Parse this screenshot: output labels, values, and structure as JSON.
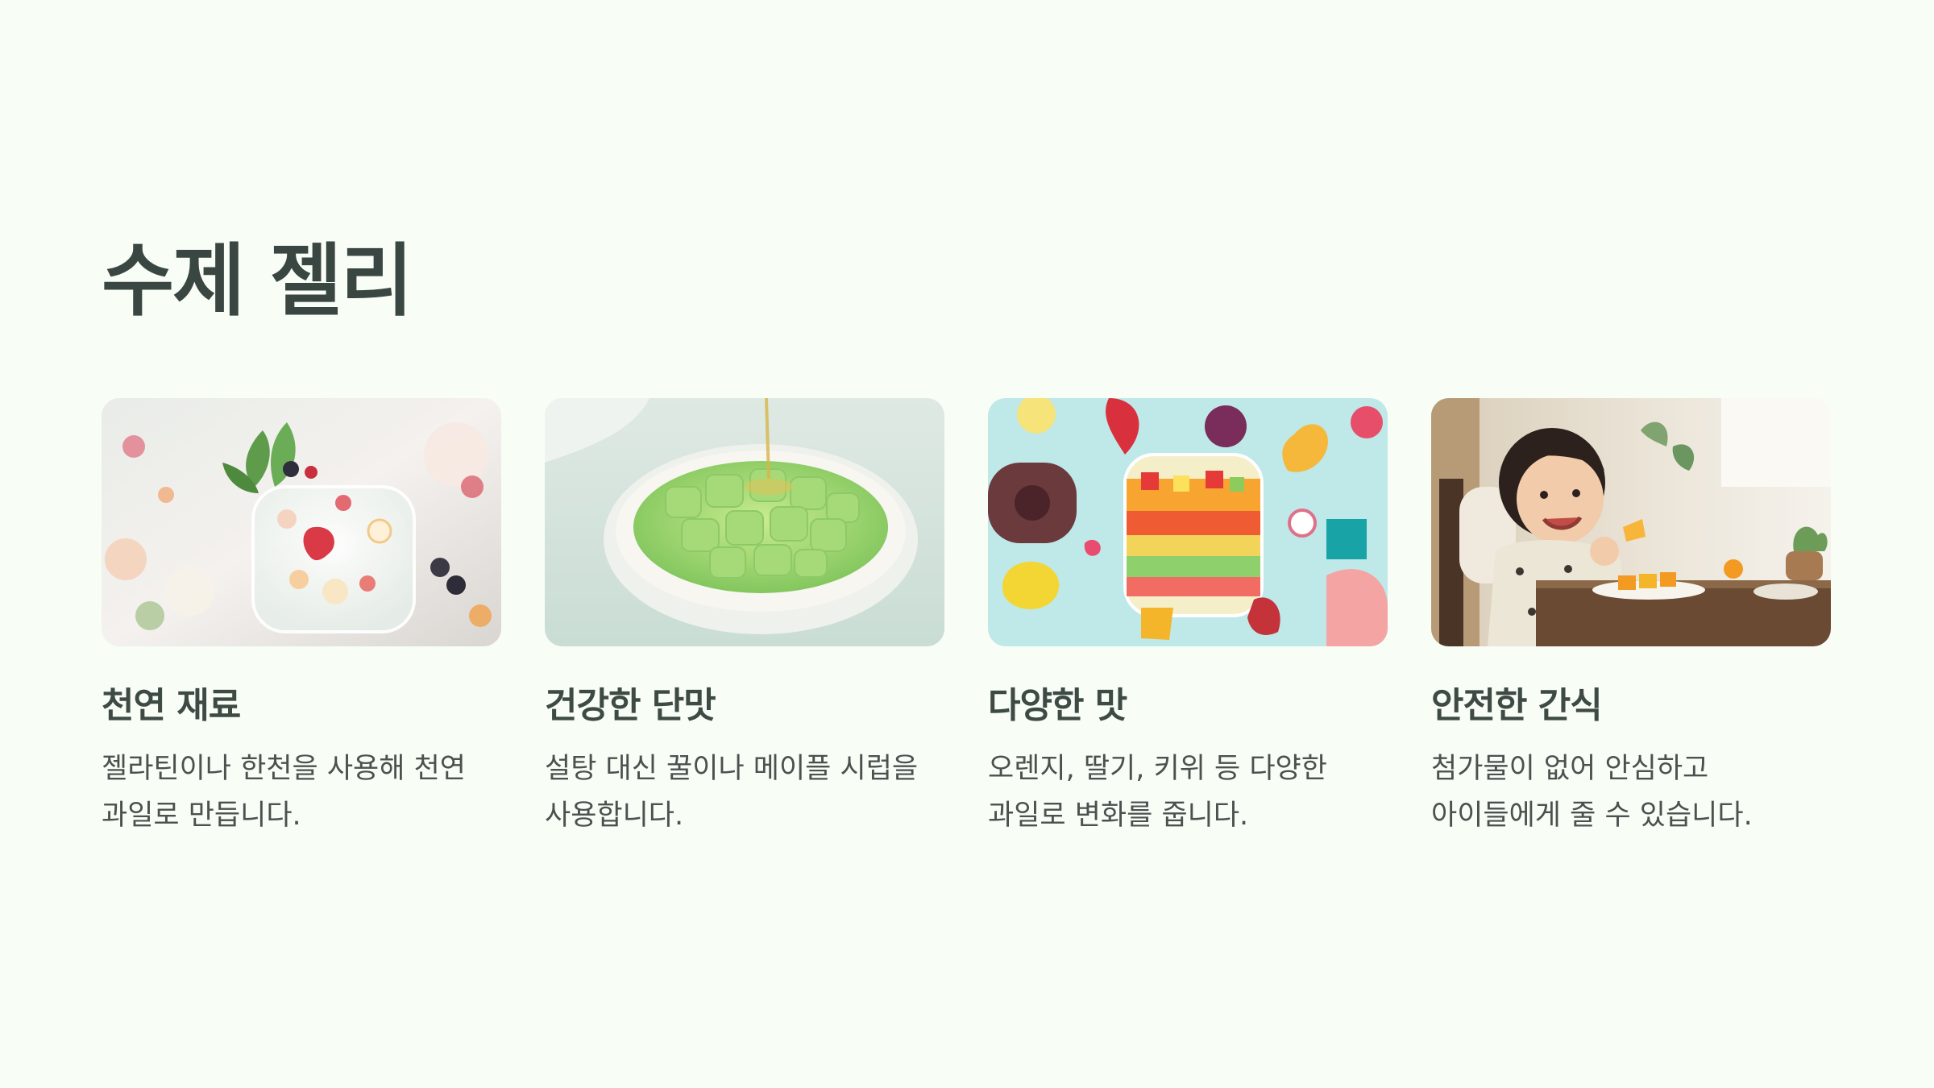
{
  "page": {
    "title": "수제 젤리"
  },
  "cards": [
    {
      "title": "천연 재료",
      "text": "젤라틴이나 한천을 사용해 천연 과일로 만듭니다."
    },
    {
      "title": "건강한 단맛",
      "text": "설탕 대신 꿀이나 메이플 시럽을 사용합니다."
    },
    {
      "title": "다양한 맛",
      "text": "오렌지, 딸기, 키위 등 다양한 과일로 변화를 줍니다."
    },
    {
      "title": "안전한 간식",
      "text": "첨가물이 없어 안심하고 아이들에게 줄 수 있습니다."
    }
  ]
}
